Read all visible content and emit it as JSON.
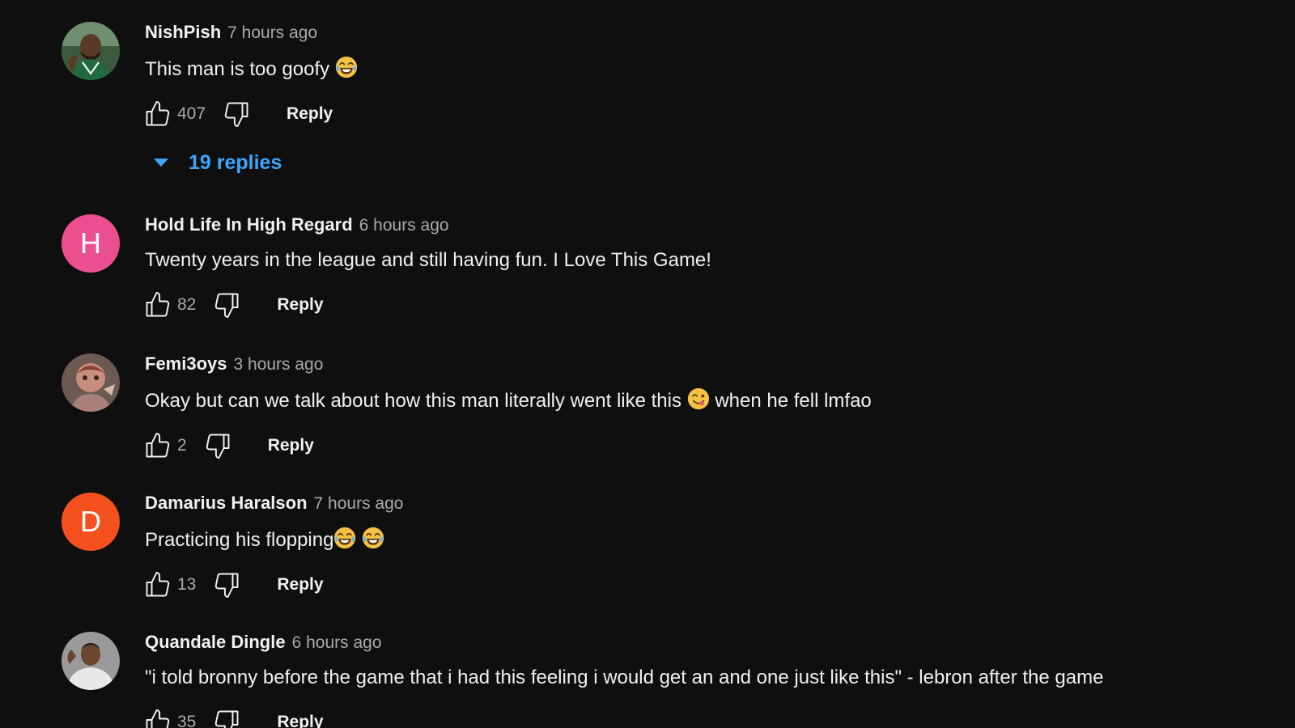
{
  "comments": [
    {
      "author": "NishPish",
      "time": "7 hours ago",
      "text_before": "This man is too goofy ",
      "emoji": "laughing",
      "likes": "407",
      "reply": "Reply",
      "replies_label": "19 replies",
      "avatar": {
        "type": "image",
        "icon": "basketball-player-avatar"
      }
    },
    {
      "author": "Hold Life In High Regard",
      "time": "6 hours ago",
      "text": "Twenty years in the league and still having fun. I Love This Game!",
      "likes": "82",
      "reply": "Reply",
      "avatar": {
        "type": "initial",
        "letter": "H",
        "color": "#ec4f8f"
      }
    },
    {
      "author": "Femi3oys",
      "time": "3 hours ago",
      "text_before": "Okay but can we talk about how this man literally went like this ",
      "emoji": "yum",
      "text_after": " when he fell lmfao",
      "likes": "2",
      "reply": "Reply",
      "avatar": {
        "type": "image",
        "icon": "character-avatar"
      }
    },
    {
      "author": "Damarius Haralson",
      "time": "7 hours ago",
      "text_before": "Practicing his flopping",
      "emoji": "laughing",
      "text_after": "",
      "likes": "13",
      "reply": "Reply",
      "avatar": {
        "type": "initial",
        "letter": "D",
        "color": "#f4511e"
      }
    },
    {
      "author": "Quandale Dingle",
      "time": "6 hours ago",
      "text": "\"i told bronny before the game that i had this feeling i would get an and one just like this\" - lebron after the game",
      "likes": "35",
      "reply": "Reply",
      "avatar": {
        "type": "image",
        "icon": "person-avatar"
      }
    }
  ],
  "colors": {
    "background": "#0f0f0f",
    "text": "#f1f1f1",
    "secondary": "#aaaaaa",
    "link": "#3ea6ff"
  }
}
